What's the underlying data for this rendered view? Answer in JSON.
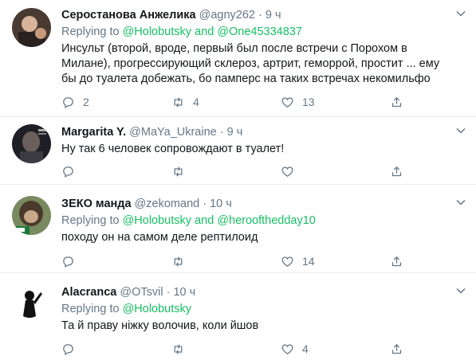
{
  "tweets": [
    {
      "name": "Серостанова Анжелика",
      "handle": "@agny262",
      "sep": "·",
      "time": "9 ч",
      "reply_prefix": "Replying to",
      "reply_mentions": [
        "@Holobutsky",
        "@One45334837"
      ],
      "reply_and": "and",
      "text_lines": [
        "Инсульт (второй, вроде, первый был после встречи с Порохом в",
        "Милане), прогрессирующий склероз, артрит, геморрой, простит ... ему",
        "бы до туалета добежать, бо памперс на таких встречах некомильфо"
      ],
      "replies": "2",
      "retweets": "4",
      "likes": "13"
    },
    {
      "name": "Margarita Y.",
      "handle": "@MaYa_Ukraine",
      "sep": "·",
      "time": "9 ч",
      "text_lines": [
        "Ну так 6 человек сопровождают в туалет!"
      ],
      "replies": "",
      "retweets": "",
      "likes": ""
    },
    {
      "name": "ЗЕКО манда",
      "handle": "@zekomand",
      "sep": "·",
      "time": "10 ч",
      "reply_prefix": "Replying to",
      "reply_mentions": [
        "@Holobutsky",
        "@heroofthedday10"
      ],
      "reply_and": "and",
      "text_lines": [
        "походу он на самом деле рептилоид"
      ],
      "replies": "",
      "retweets": "",
      "likes": "14"
    },
    {
      "name": "Alacranca",
      "handle": "@OTsvil",
      "sep": "·",
      "time": "10 ч",
      "reply_prefix": "Replying to",
      "reply_mentions": [
        "@Holobutsky"
      ],
      "text_lines": [
        "Та й праву ніжку волочив, коли йшов"
      ],
      "replies": "",
      "retweets": "",
      "likes": "4"
    }
  ],
  "colors": {
    "text": "#14171a",
    "muted": "#657786",
    "link": "#17bf63",
    "divider": "#e6ecf0"
  },
  "icons": [
    "reply-icon",
    "retweet-icon",
    "like-icon",
    "share-icon",
    "chevron-down-icon"
  ]
}
